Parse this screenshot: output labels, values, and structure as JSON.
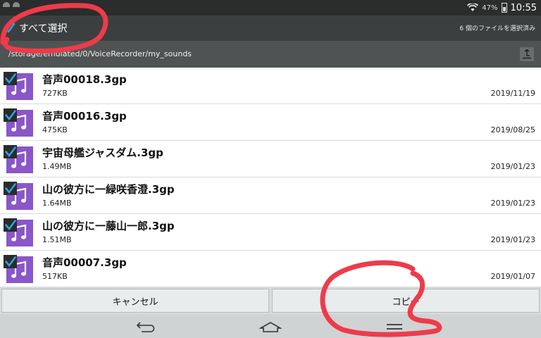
{
  "status_bar": {
    "battery": "47%",
    "time": "10:55"
  },
  "action_bar": {
    "select_all": "すべて選択",
    "selected_count": "6 個のファイルを選択済み"
  },
  "path_bar": {
    "path": "/storage/emulated/0/VoiceRecorder/my_sounds"
  },
  "files": [
    {
      "name": "音声00018.3gp",
      "size": "727KB",
      "date": "2019/11/19"
    },
    {
      "name": "音声00016.3gp",
      "size": "475KB",
      "date": "2019/08/25"
    },
    {
      "name": "宇宙母艦ジャスダム.3gp",
      "size": "1.49MB",
      "date": "2019/01/23"
    },
    {
      "name": "山の彼方に一緑咲香澄.3gp",
      "size": "1.64MB",
      "date": "2019/01/23"
    },
    {
      "name": "山の彼方に一藤山一郎.3gp",
      "size": "1.51MB",
      "date": "2019/01/23"
    },
    {
      "name": "音声00007.3gp",
      "size": "517KB",
      "date": "2019/01/07"
    }
  ],
  "buttons": {
    "cancel": "キャンセル",
    "copy": "コピー"
  },
  "colors": {
    "accent_check": "#2aa3e0",
    "file_icon": "#8a56c9",
    "annotation": "#ee3b4a"
  },
  "icons": [
    "wifi-icon",
    "battery-icon",
    "check-icon",
    "up-folder-icon",
    "music-note-icon",
    "back-icon",
    "home-icon",
    "recent-apps-icon"
  ]
}
